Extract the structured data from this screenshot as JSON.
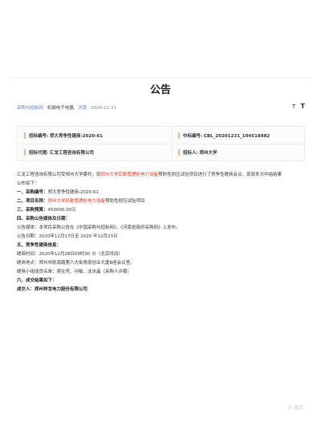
{
  "notice": {
    "title": "公告",
    "breadcrumb": "采购与招标网",
    "category": "机械电子电器,",
    "region": "河南",
    "date": "2020-12-31",
    "font_small": "T",
    "font_large": "T"
  },
  "info": {
    "bid_no_label": "招标编号:",
    "bid_no": "郑大竞争性磋商-2020-61",
    "award_no_label": "中标编号:",
    "award_no": "CBL_20201231_104518882",
    "agency_label": "招标代理:",
    "agency": "汇龙工程咨询有限公司",
    "purchaser_label": "招标人:",
    "purchaser": "郑州大学"
  },
  "content": {
    "intro_a": "汇龙工程咨询有限公司受郑州大学委托，就",
    "intro_red": "郑州大学后勤管理处电力设备",
    "intro_b": "预防性耐压试验项目进行了竞争性磋商会议，现就本次中结结果",
    "intro_c": "公布如下：",
    "s1_head": "一、采购编号：",
    "s1_value": "郑大竞争性磋商-2020-61",
    "s2_head": "二、项目名称：",
    "s2_red": "郑州大学后勤管理处电力设备",
    "s2_rest": "预防性耐压试验项目",
    "s3_head": "三、采购预算：",
    "s3_value": "450000.00元",
    "s4_head": "四、采购公告媒体及日期：",
    "s4_line1": "公告媒体：本项目采购公告在《中国采购与招标网》、《河南省政府采购网》上发布。",
    "s4_line2": "公告日期：2020年12月17日至 2020 年12月23日",
    "s5_head": "五、竞争性磋商信息：",
    "s5_line1": "磋商时间：2020年12月28日09时30 分（北京时间）",
    "s5_line2": "磋商地点：郑州市航海路第六大街青原创业大厦B座会议室。",
    "s5_line3": "磋商小组成员名单：梁壮壳、孙敏、沈水晶（采购人评委）",
    "s6_head": "六、成交结果如下：",
    "s6_line1": "成交人：郑州祥龙电力股份有限公司"
  },
  "watermark": "@ 路京"
}
